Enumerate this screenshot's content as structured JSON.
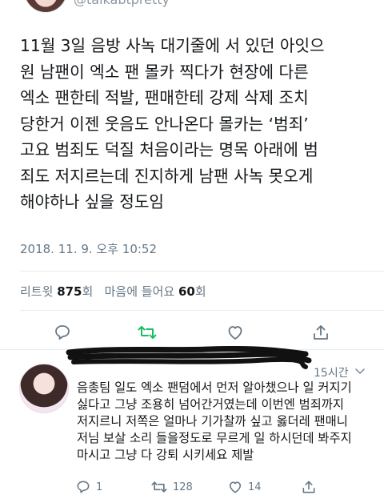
{
  "tweet": {
    "handle": "@talkabtpretty",
    "text": "11월 3일 음방 사녹 대기줄에 서 있던 아잇으\n원 남팬이 엑소 팬 몰카 찍다가 현장에 다른\n엑소 팬한테 적발, 팬매한테 강제 삭제 조치\n당한거 이젠 웃음도 안나온다 몰카는 ‘범죄’\n고요 범죄도 덕질 처음이라는 명목 아래에 범\n죄도 저지르는데 진지하게 남팬 사녹 못오게\n해야하나 싶을 정도임",
    "timestamp": "2018. 11. 9. 오후 10:52",
    "stats": {
      "retweets_label": "리트윗",
      "retweets": "875",
      "unit": "회",
      "likes_label": "마음에 들어요",
      "likes": "60"
    }
  },
  "reply": {
    "time": "15시간",
    "text": "음총팀 일도 엑소 팬덤에서 먼저 알아챘으나 일 커지기\n싫다고 그냥 조용히 넘어간거였는데 이번엔 범죄까지\n저지르니 저쪽은 얼마나 기가찰까 싶고 옳더레 팬매니\n저님 보살 소리 들을정도로 무르게 일 하시던데 봐주지\n마시고 그냥 다 강퇴 시키세요 제발",
    "counts": {
      "replies": "1",
      "retweets": "128",
      "likes": "14"
    }
  },
  "colors": {
    "retweet_active": "#17bf63",
    "icon_gray": "#657786",
    "text": "#14171a"
  }
}
